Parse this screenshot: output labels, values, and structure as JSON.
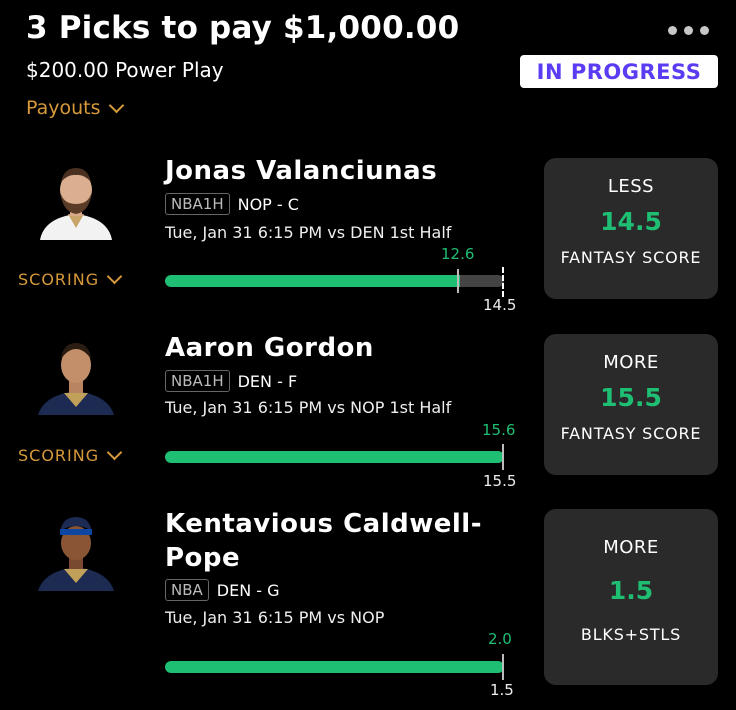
{
  "header": {
    "title": "3 Picks to pay $1,000.00",
    "subtitle": "$200.00 Power Play",
    "status": "IN PROGRESS",
    "payouts_label": "Payouts"
  },
  "picks": [
    {
      "name": "Jonas Valanciunas",
      "league": "NBA1H",
      "team_pos": "NOP - C",
      "game": "Tue, Jan 31 6:15 PM  vs DEN 1st Half",
      "current": "12.6",
      "line": "14.5",
      "progress": 0.87,
      "direction": "LESS",
      "stat": "FANTASY SCORE",
      "scoring_label": "SCORING"
    },
    {
      "name": "Aaron Gordon",
      "league": "NBA1H",
      "team_pos": "DEN - F",
      "game": "Tue, Jan 31 6:15 PM  vs NOP 1st Half",
      "current": "15.6",
      "line": "15.5",
      "progress": 1.0,
      "direction": "MORE",
      "stat": "FANTASY SCORE",
      "scoring_label": "SCORING"
    },
    {
      "name": "Kentavious Caldwell-Pope",
      "league": "NBA",
      "team_pos": "DEN - G",
      "game": "Tue, Jan 31 6:15 PM  vs NOP",
      "current": "2.0",
      "line": "1.5",
      "progress": 1.0,
      "direction": "MORE",
      "stat": "BLKS+STLS"
    }
  ],
  "colors": {
    "accent_green": "#1fbf73",
    "scoring_orange": "#d79a3a",
    "status_purple": "#5b3cf2",
    "card_bg": "#2a2a2a"
  },
  "icons": [
    "more-options-icon",
    "chevron-down-icon",
    "player-avatar"
  ]
}
